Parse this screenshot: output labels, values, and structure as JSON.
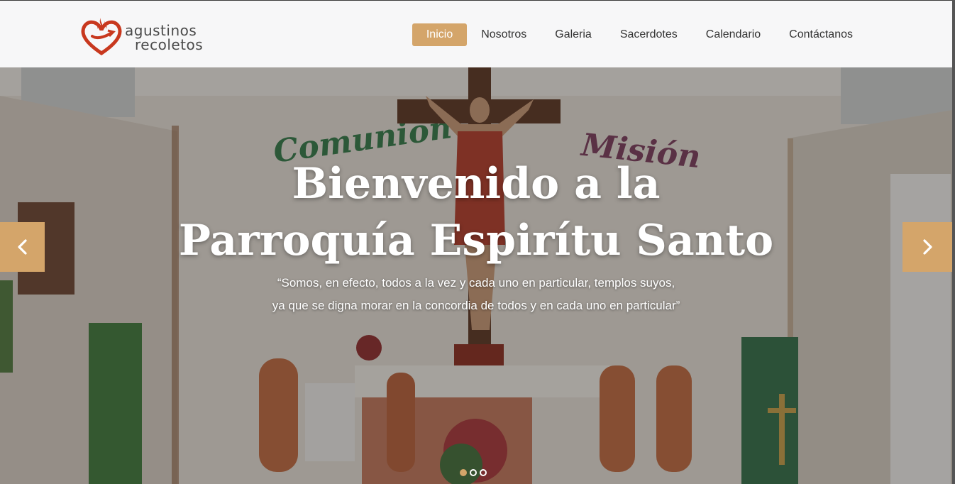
{
  "brand": {
    "line1": "agustinos",
    "line2": "recoletos"
  },
  "nav": [
    {
      "label": "Inicio",
      "active": true
    },
    {
      "label": "Nosotros"
    },
    {
      "label": "Galeria"
    },
    {
      "label": "Sacerdotes"
    },
    {
      "label": "Calendario"
    },
    {
      "label": "Contáctanos"
    }
  ],
  "hero": {
    "title_line1": "Bienvenido a la",
    "title_line2": "Parroquía Espirítu Santo",
    "quote_line1": "“Somos, en efecto, todos a la vez y cada uno en particular, templos suyos,",
    "quote_line2": "ya que se digna morar en la concordia de todos y en cada uno en particular”",
    "wall_text_left": "Comunión",
    "wall_text_right": "Misión"
  },
  "carousel": {
    "slides": 3,
    "active_index": 0
  },
  "colors": {
    "accent": "#d4a56a",
    "logo_red": "#c8381e"
  },
  "icons": {
    "prev": "chevron-left-icon",
    "next": "chevron-right-icon",
    "logo": "flaming-heart-icon"
  }
}
